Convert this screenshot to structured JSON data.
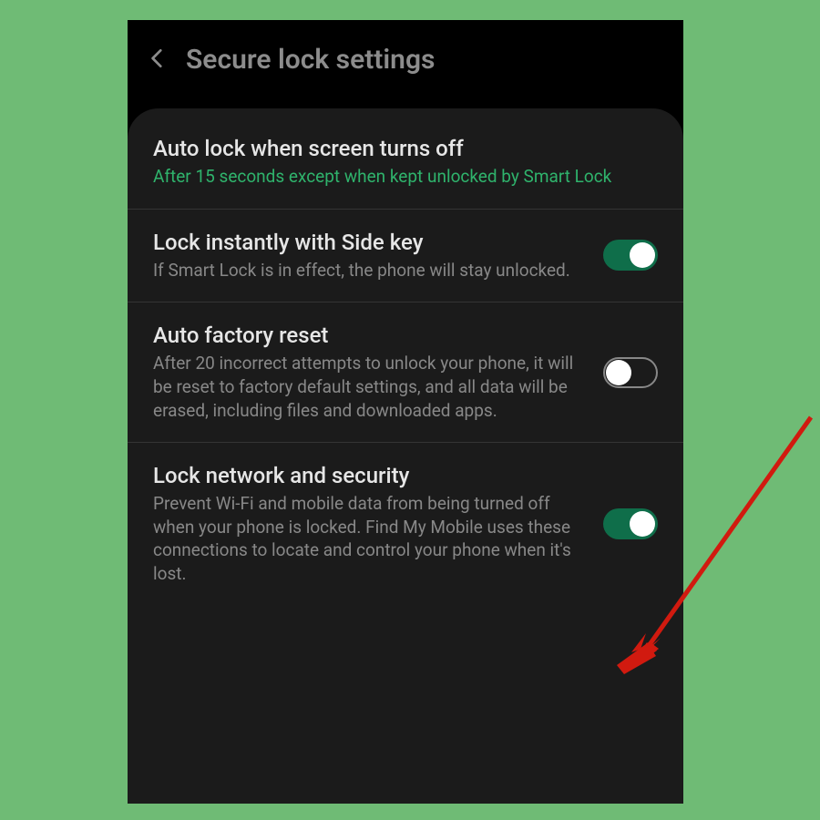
{
  "header": {
    "title": "Secure lock settings"
  },
  "items": [
    {
      "title": "Auto lock when screen turns off",
      "desc": "After 15 seconds except when kept unlocked by Smart Lock",
      "desc_accent": true,
      "toggle": null
    },
    {
      "title": "Lock instantly with Side key",
      "desc": "If Smart Lock is in effect, the phone will stay unlocked.",
      "desc_accent": false,
      "toggle": true
    },
    {
      "title": "Auto factory reset",
      "desc": "After 20 incorrect attempts to unlock your phone, it will be reset to factory default settings, and all data will be erased, including files and downloaded apps.",
      "desc_accent": false,
      "toggle": false
    },
    {
      "title": "Lock network and security",
      "desc": "Prevent Wi-Fi and mobile data from being turned off when your phone is locked. Find My Mobile uses these connections to locate and control your phone when it's lost.",
      "desc_accent": false,
      "toggle": true
    }
  ],
  "colors": {
    "accent": "#0f6e4a",
    "arrow": "#d11a0f"
  }
}
